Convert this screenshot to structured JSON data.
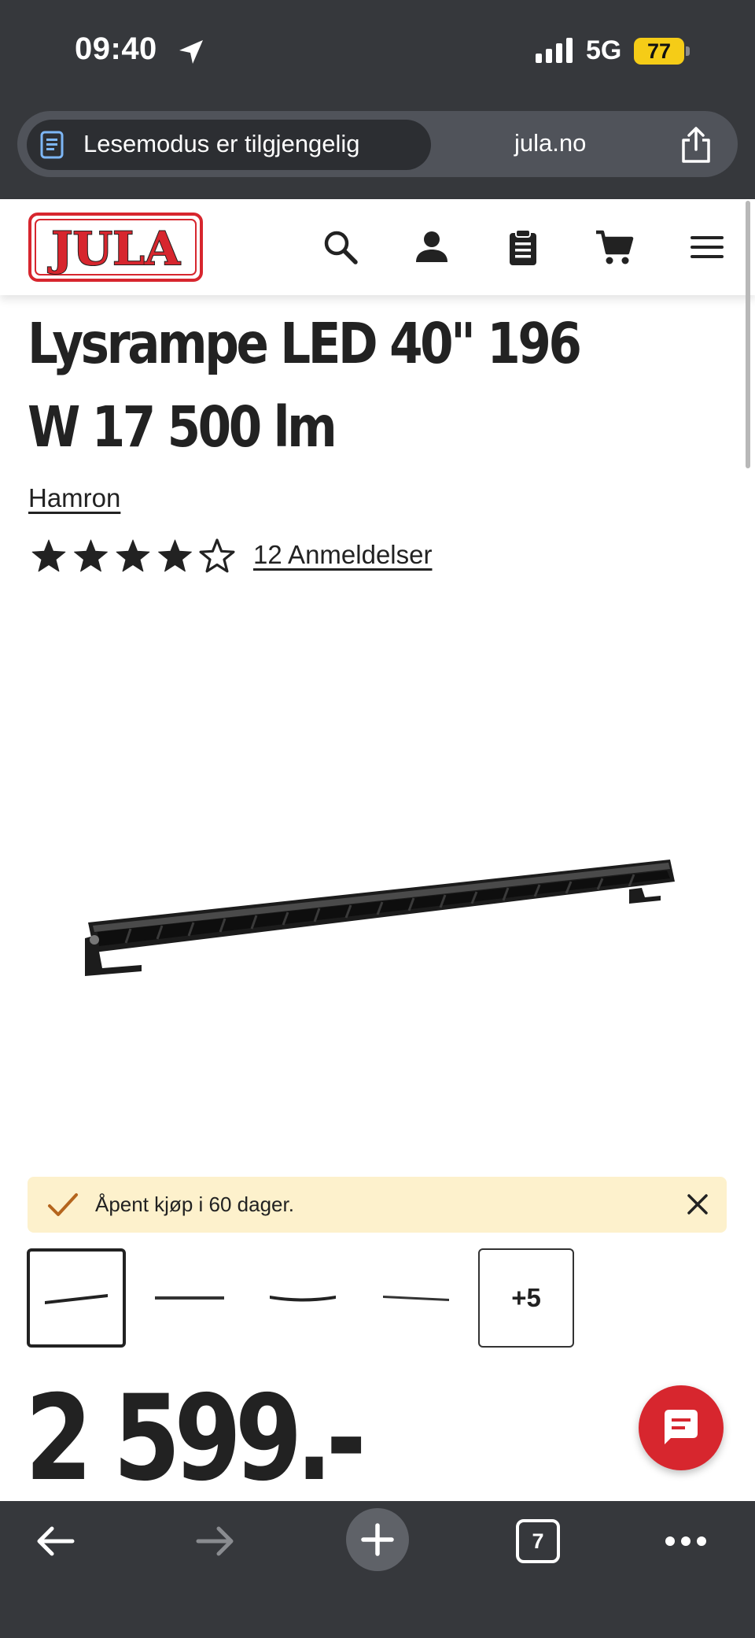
{
  "status_bar": {
    "time": "09:40",
    "network": "5G",
    "battery": "77"
  },
  "browser": {
    "reader_mode_label": "Lesemodus er tilgjengelig",
    "domain": "jula.no",
    "tabs_count": "7"
  },
  "header": {
    "logo_text": "JULA",
    "icons": [
      "search-icon",
      "account-icon",
      "shopping-list-icon",
      "cart-icon",
      "menu-icon"
    ]
  },
  "product": {
    "title": "Lysrampe LED 40\" 196 W 17 500 lm",
    "brand": "Hamron",
    "rating": 4,
    "rating_max": 5,
    "reviews_label": "12 Anmeldelser",
    "price": "2 599.-"
  },
  "notice": {
    "text": "Åpent kjøp i 60 dager."
  },
  "gallery": {
    "more_label": "+5"
  },
  "colors": {
    "brand_red": "#d7262e",
    "notice_bg": "#fdf1cc",
    "chrome_bg": "#36383c",
    "battery_yellow": "#f5cc17"
  }
}
